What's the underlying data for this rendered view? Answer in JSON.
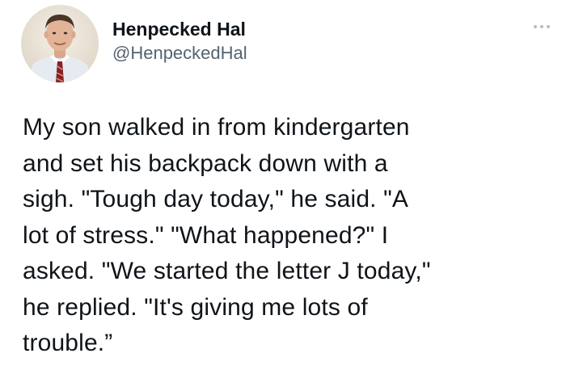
{
  "author": {
    "display_name": "Henpecked Hal",
    "handle": "@HenpeckedHal",
    "avatar_icon": "profile-photo"
  },
  "header": {
    "more_icon": "more-options-icon"
  },
  "tweet": {
    "lines": [
      "My son walked in from kindergarten",
      "and set his backpack down with a",
      "sigh. \"Tough day today,\" he said. \"A",
      "lot of stress.\" \"What happened?\" I",
      "asked. \"We started the letter J today,\"",
      "he replied. \"It's giving me lots of",
      "trouble.”"
    ]
  },
  "colors": {
    "text": "#0f1419",
    "secondary_text": "#536471",
    "background": "#ffffff"
  }
}
